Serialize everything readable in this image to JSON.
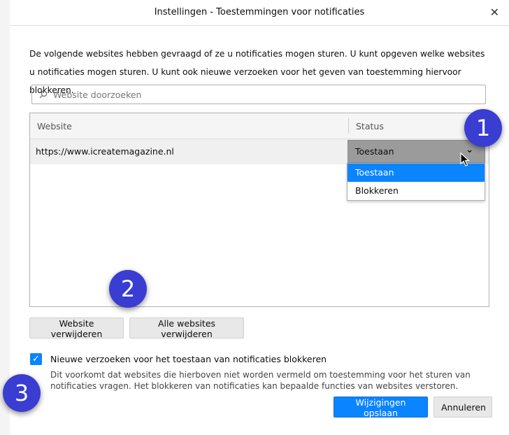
{
  "window": {
    "title": "Instellingen - Toestemmingen voor notificaties",
    "close_glyph": "✕"
  },
  "description": "De volgende websites hebben gevraagd of ze u notificaties mogen sturen. U kunt opgeven welke websites u notificaties mogen sturen. U kunt ook nieuwe verzoeken voor het geven van toestemming hiervoor blokkeren.",
  "search": {
    "placeholder": "Website doorzoeken"
  },
  "table": {
    "columns": [
      "Website",
      "Status"
    ],
    "rows": [
      {
        "website": "https://www.icreatemagazine.nl",
        "status": "Toestaan"
      }
    ]
  },
  "dropdown": {
    "options": [
      "Toestaan",
      "Blokkeren"
    ],
    "selected": "Toestaan"
  },
  "buttons": {
    "remove_site": "Website verwijderen",
    "remove_all": "Alle websites verwijderen",
    "save": "Wijzigingen opslaan",
    "cancel": "Annuleren"
  },
  "block_new": {
    "checked": true,
    "label": "Nieuwe verzoeken voor het toestaan van notificaties blokkeren",
    "note": "Dit voorkomt dat websites die hierboven niet worden vermeld om toestemming voor het sturen van notificaties vragen. Het blokkeren van notificaties kan bepaalde functies van websites verstoren."
  },
  "badges": [
    "1",
    "2",
    "3"
  ],
  "colors": {
    "accent": "#0a84ff",
    "badge": "#3a3dd1",
    "selected_select": "#9b9b9b"
  }
}
